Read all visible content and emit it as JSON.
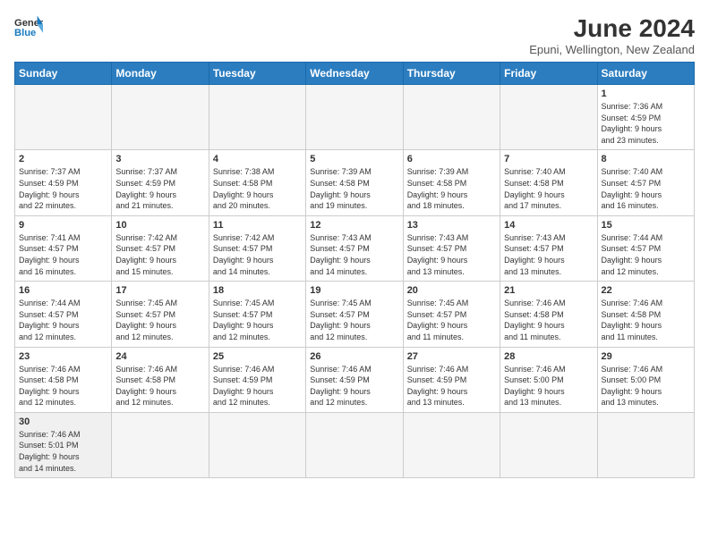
{
  "logo": {
    "line1": "General",
    "line2": "Blue"
  },
  "title": "June 2024",
  "subtitle": "Epuni, Wellington, New Zealand",
  "days_of_week": [
    "Sunday",
    "Monday",
    "Tuesday",
    "Wednesday",
    "Thursday",
    "Friday",
    "Saturday"
  ],
  "weeks": [
    [
      {
        "num": "",
        "info": ""
      },
      {
        "num": "",
        "info": ""
      },
      {
        "num": "",
        "info": ""
      },
      {
        "num": "",
        "info": ""
      },
      {
        "num": "",
        "info": ""
      },
      {
        "num": "",
        "info": ""
      },
      {
        "num": "1",
        "info": "Sunrise: 7:36 AM\nSunset: 4:59 PM\nDaylight: 9 hours\nand 23 minutes."
      }
    ],
    [
      {
        "num": "2",
        "info": "Sunrise: 7:37 AM\nSunset: 4:59 PM\nDaylight: 9 hours\nand 22 minutes."
      },
      {
        "num": "3",
        "info": "Sunrise: 7:37 AM\nSunset: 4:59 PM\nDaylight: 9 hours\nand 21 minutes."
      },
      {
        "num": "4",
        "info": "Sunrise: 7:38 AM\nSunset: 4:58 PM\nDaylight: 9 hours\nand 20 minutes."
      },
      {
        "num": "5",
        "info": "Sunrise: 7:39 AM\nSunset: 4:58 PM\nDaylight: 9 hours\nand 19 minutes."
      },
      {
        "num": "6",
        "info": "Sunrise: 7:39 AM\nSunset: 4:58 PM\nDaylight: 9 hours\nand 18 minutes."
      },
      {
        "num": "7",
        "info": "Sunrise: 7:40 AM\nSunset: 4:58 PM\nDaylight: 9 hours\nand 17 minutes."
      },
      {
        "num": "8",
        "info": "Sunrise: 7:40 AM\nSunset: 4:57 PM\nDaylight: 9 hours\nand 16 minutes."
      }
    ],
    [
      {
        "num": "9",
        "info": "Sunrise: 7:41 AM\nSunset: 4:57 PM\nDaylight: 9 hours\nand 16 minutes."
      },
      {
        "num": "10",
        "info": "Sunrise: 7:42 AM\nSunset: 4:57 PM\nDaylight: 9 hours\nand 15 minutes."
      },
      {
        "num": "11",
        "info": "Sunrise: 7:42 AM\nSunset: 4:57 PM\nDaylight: 9 hours\nand 14 minutes."
      },
      {
        "num": "12",
        "info": "Sunrise: 7:43 AM\nSunset: 4:57 PM\nDaylight: 9 hours\nand 14 minutes."
      },
      {
        "num": "13",
        "info": "Sunrise: 7:43 AM\nSunset: 4:57 PM\nDaylight: 9 hours\nand 13 minutes."
      },
      {
        "num": "14",
        "info": "Sunrise: 7:43 AM\nSunset: 4:57 PM\nDaylight: 9 hours\nand 13 minutes."
      },
      {
        "num": "15",
        "info": "Sunrise: 7:44 AM\nSunset: 4:57 PM\nDaylight: 9 hours\nand 12 minutes."
      }
    ],
    [
      {
        "num": "16",
        "info": "Sunrise: 7:44 AM\nSunset: 4:57 PM\nDaylight: 9 hours\nand 12 minutes."
      },
      {
        "num": "17",
        "info": "Sunrise: 7:45 AM\nSunset: 4:57 PM\nDaylight: 9 hours\nand 12 minutes."
      },
      {
        "num": "18",
        "info": "Sunrise: 7:45 AM\nSunset: 4:57 PM\nDaylight: 9 hours\nand 12 minutes."
      },
      {
        "num": "19",
        "info": "Sunrise: 7:45 AM\nSunset: 4:57 PM\nDaylight: 9 hours\nand 12 minutes."
      },
      {
        "num": "20",
        "info": "Sunrise: 7:45 AM\nSunset: 4:57 PM\nDaylight: 9 hours\nand 11 minutes."
      },
      {
        "num": "21",
        "info": "Sunrise: 7:46 AM\nSunset: 4:58 PM\nDaylight: 9 hours\nand 11 minutes."
      },
      {
        "num": "22",
        "info": "Sunrise: 7:46 AM\nSunset: 4:58 PM\nDaylight: 9 hours\nand 11 minutes."
      }
    ],
    [
      {
        "num": "23",
        "info": "Sunrise: 7:46 AM\nSunset: 4:58 PM\nDaylight: 9 hours\nand 12 minutes."
      },
      {
        "num": "24",
        "info": "Sunrise: 7:46 AM\nSunset: 4:58 PM\nDaylight: 9 hours\nand 12 minutes."
      },
      {
        "num": "25",
        "info": "Sunrise: 7:46 AM\nSunset: 4:59 PM\nDaylight: 9 hours\nand 12 minutes."
      },
      {
        "num": "26",
        "info": "Sunrise: 7:46 AM\nSunset: 4:59 PM\nDaylight: 9 hours\nand 12 minutes."
      },
      {
        "num": "27",
        "info": "Sunrise: 7:46 AM\nSunset: 4:59 PM\nDaylight: 9 hours\nand 13 minutes."
      },
      {
        "num": "28",
        "info": "Sunrise: 7:46 AM\nSunset: 5:00 PM\nDaylight: 9 hours\nand 13 minutes."
      },
      {
        "num": "29",
        "info": "Sunrise: 7:46 AM\nSunset: 5:00 PM\nDaylight: 9 hours\nand 13 minutes."
      }
    ],
    [
      {
        "num": "30",
        "info": "Sunrise: 7:46 AM\nSunset: 5:01 PM\nDaylight: 9 hours\nand 14 minutes."
      },
      {
        "num": "",
        "info": ""
      },
      {
        "num": "",
        "info": ""
      },
      {
        "num": "",
        "info": ""
      },
      {
        "num": "",
        "info": ""
      },
      {
        "num": "",
        "info": ""
      },
      {
        "num": "",
        "info": ""
      }
    ]
  ]
}
